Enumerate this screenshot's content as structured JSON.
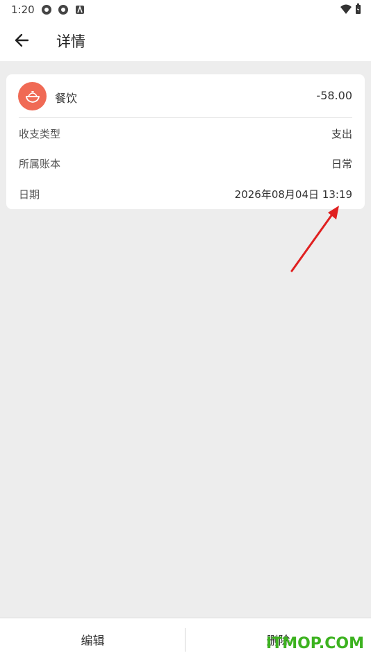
{
  "status_bar": {
    "time": "1:20"
  },
  "app_bar": {
    "title": "详情"
  },
  "record": {
    "category": "餐饮",
    "amount": "-58.00",
    "icon_color": "#f06a55",
    "fields": [
      {
        "label": "收支类型",
        "value": "支出"
      },
      {
        "label": "所属账本",
        "value": "日常"
      },
      {
        "label": "日期",
        "value": "2026年08月04日 13:19"
      }
    ]
  },
  "bottom_bar": {
    "edit_label": "编辑",
    "delete_label": "删除"
  },
  "watermark": "ITMOP.COM",
  "colors": {
    "annotation_arrow": "#e02020",
    "watermark": "#3cb21f"
  }
}
